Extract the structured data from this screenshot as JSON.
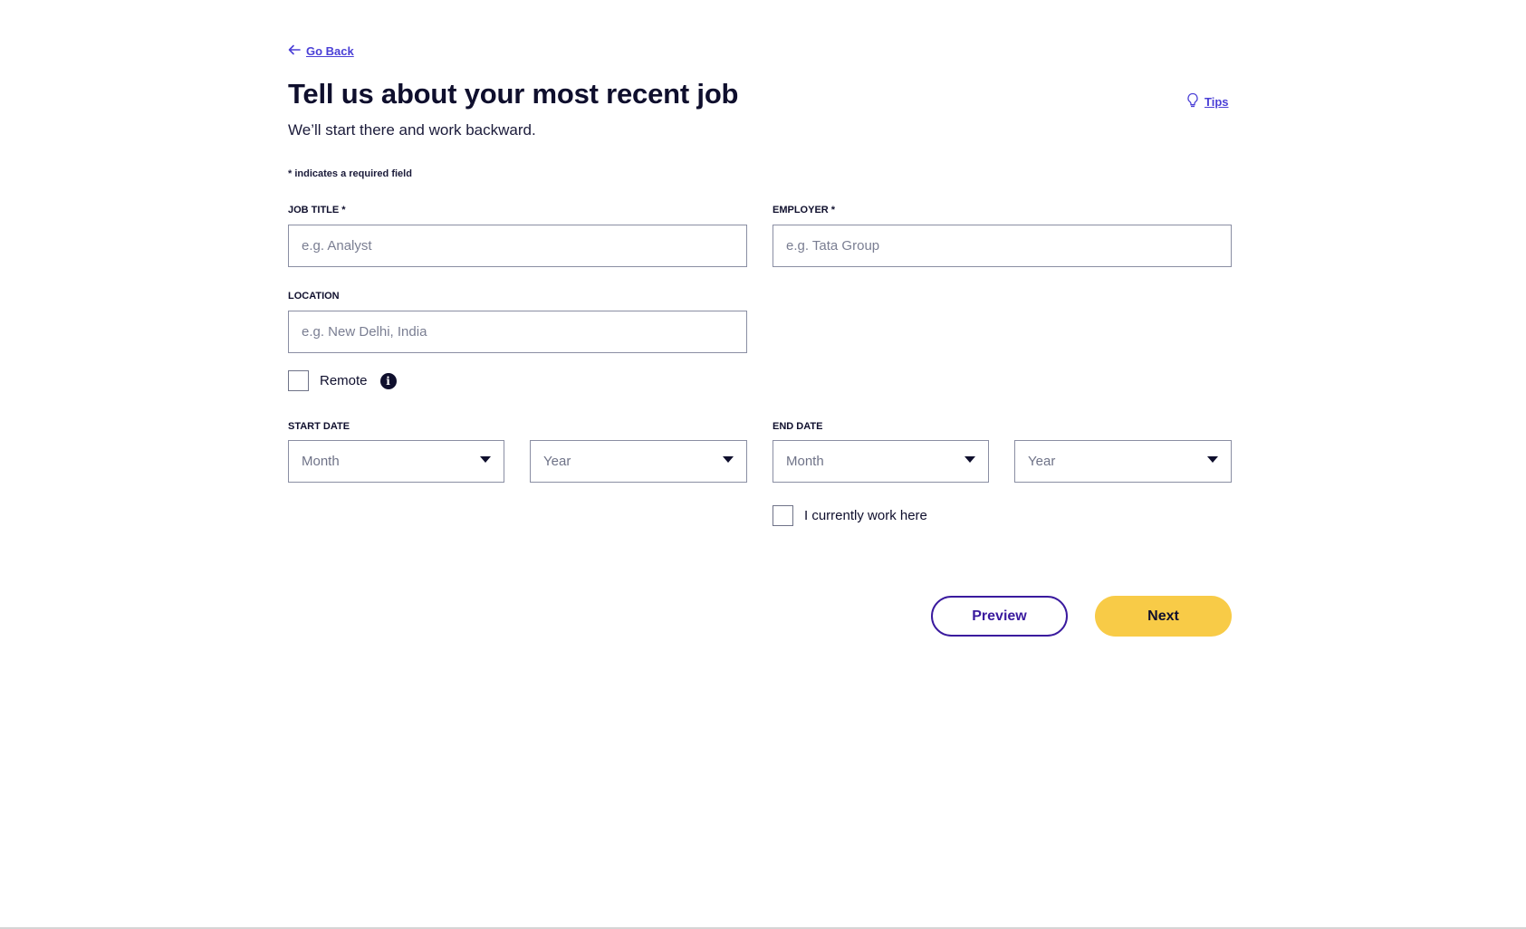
{
  "nav": {
    "back_label": "Go Back",
    "back_icon": "arrow-left-icon"
  },
  "header": {
    "title": "Tell us about your most recent job",
    "subtitle": "We’ll start there and work backward.",
    "tips_label": "Tips",
    "tips_icon": "lightbulb-icon"
  },
  "form": {
    "required_note": "* indicates a required field",
    "job_title": {
      "label": "JOB TITLE *",
      "placeholder": "e.g. Analyst",
      "value": ""
    },
    "employer": {
      "label": "EMPLOYER *",
      "placeholder": "e.g. Tata Group",
      "value": ""
    },
    "location": {
      "label": "LOCATION",
      "placeholder": "e.g. New Delhi, India",
      "value": ""
    },
    "remote": {
      "label": "Remote",
      "checked": false,
      "info_icon": "info-icon"
    },
    "start_date": {
      "label": "START DATE",
      "month": {
        "value": "Month"
      },
      "year": {
        "value": "Year"
      }
    },
    "end_date": {
      "label": "END DATE",
      "month": {
        "value": "Month"
      },
      "year": {
        "value": "Year"
      }
    },
    "currently_work": {
      "label": "I currently work here",
      "checked": false
    }
  },
  "actions": {
    "preview_label": "Preview",
    "next_label": "Next"
  },
  "colors": {
    "link": "#4a3fd6",
    "preview_border": "#3a1a9e",
    "next_bg": "#f8cb47",
    "text": "#0f0f2d"
  }
}
